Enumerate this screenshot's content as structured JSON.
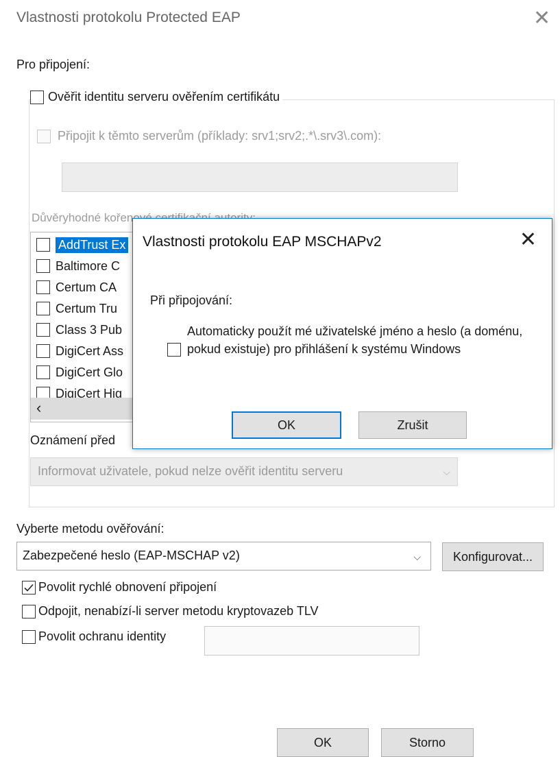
{
  "window": {
    "title": "Vlastnosti protokolu Protected EAP"
  },
  "connect": {
    "label": "Pro připojení:",
    "verify_cert": {
      "label": "Ověřit identitu serveru ověřením certifikátu",
      "checked": false
    },
    "connect_servers": {
      "label": "Připojit k těmto serverům (příklady: srv1;srv2;.*\\.srv3\\.com):",
      "checked": false,
      "value": ""
    },
    "trusted_ca_label": "Důvěryhodné kořenové certifikační autority:",
    "ca_list": [
      {
        "label": "AddTrust Ex",
        "checked": false,
        "selected": true
      },
      {
        "label": "Baltimore C",
        "checked": false,
        "selected": false
      },
      {
        "label": "Certum CA",
        "checked": false,
        "selected": false
      },
      {
        "label": "Certum Tru",
        "checked": false,
        "selected": false
      },
      {
        "label": "Class 3 Pub",
        "checked": false,
        "selected": false
      },
      {
        "label": "DigiCert Ass",
        "checked": false,
        "selected": false
      },
      {
        "label": "DigiCert Glo",
        "checked": false,
        "selected": false
      },
      {
        "label": "DigiCert Hig",
        "checked": false,
        "selected": false
      }
    ],
    "notification_label": "Oznámení před",
    "notification_value": "Informovat uživatele, pokud nelze ověřit identitu serveru"
  },
  "method": {
    "label": "Vyberte metodu ověřování:",
    "selected": "Zabezpečené heslo (EAP-MSCHAP v2)",
    "configure_label": "Konfigurovat..."
  },
  "options": [
    {
      "label": "Povolit rychlé obnovení připojení",
      "checked": true
    },
    {
      "label": "Odpojit, nenabízí-li server metodu kryptovazeb TLV",
      "checked": false
    },
    {
      "label": "Povolit ochranu identity",
      "checked": false
    }
  ],
  "footer": {
    "ok_label": "OK",
    "cancel_label": "Storno"
  },
  "modal": {
    "title": "Vlastnosti protokolu EAP MSCHAPv2",
    "close_glyph": "✕",
    "section_label": "Při připojování:",
    "auto_login_label": "Automaticky použít mé uživatelské jméno a heslo (a doménu, pokud existuje) pro přihlášení k systému Windows",
    "auto_login_checked": false,
    "ok_label": "OK",
    "cancel_label": "Zrušit"
  },
  "glyphs": {
    "close": "✕",
    "chevron_down": "⌵",
    "scroll_left": "‹"
  },
  "colors": {
    "accent": "#0078d7",
    "disabled_text": "#9c9c9c"
  }
}
